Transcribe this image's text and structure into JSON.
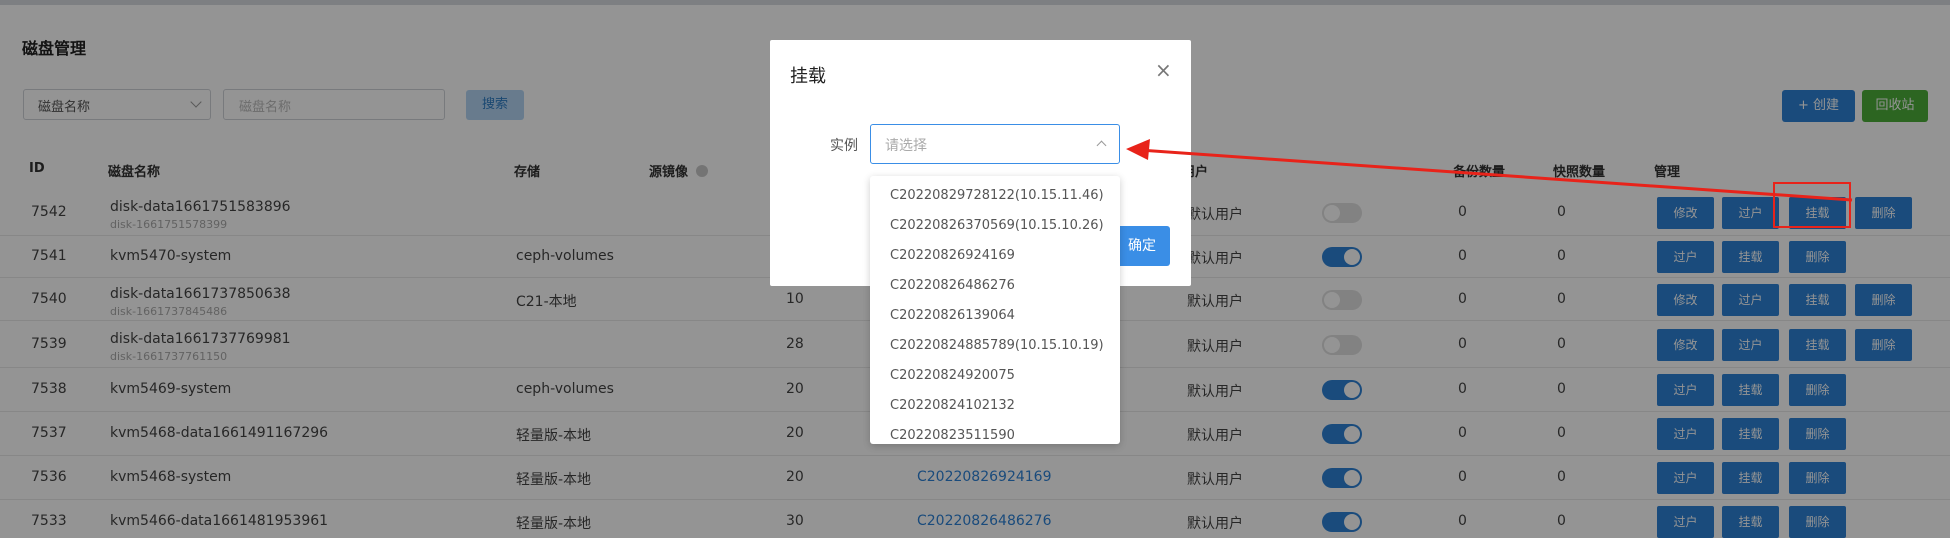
{
  "page": {
    "title": "磁盘管理",
    "filter_select": "磁盘名称",
    "search_placeholder": "磁盘名称",
    "search_button": "搜索",
    "create_button": "+ 创建",
    "recycle_button": "回收站"
  },
  "table": {
    "headers": {
      "id": "ID",
      "name": "磁盘名称",
      "storage": "存储",
      "source_image": "源镜像",
      "user": "用户",
      "backup_count": "备份数量",
      "snapshot_count": "快照数量",
      "manage": "管理"
    },
    "rows": [
      {
        "id": "7542",
        "name": "disk-data1661751583896",
        "sub": "disk-1661751578399",
        "storage": "",
        "size": "",
        "instance": "",
        "user": "默认用户",
        "toggle": false,
        "backup": "0",
        "snapshot": "0",
        "actions": [
          "修改",
          "过户",
          "挂载",
          "删除"
        ]
      },
      {
        "id": "7541",
        "name": "kvm5470-system",
        "sub": "",
        "storage": "ceph-volumes",
        "size": "",
        "instance": "",
        "user": "默认用户",
        "toggle": true,
        "backup": "0",
        "snapshot": "0",
        "actions": [
          "过户",
          "挂载",
          "删除"
        ]
      },
      {
        "id": "7540",
        "name": "disk-data1661737850638",
        "sub": "disk-1661737845486",
        "storage": "C21-本地",
        "size": "10",
        "instance": "",
        "user": "默认用户",
        "toggle": false,
        "backup": "0",
        "snapshot": "0",
        "actions": [
          "修改",
          "过户",
          "挂载",
          "删除"
        ]
      },
      {
        "id": "7539",
        "name": "disk-data1661737769981",
        "sub": "disk-1661737761150",
        "storage": "",
        "size": "28",
        "instance": "",
        "user": "默认用户",
        "toggle": false,
        "backup": "0",
        "snapshot": "0",
        "actions": [
          "修改",
          "过户",
          "挂载",
          "删除"
        ]
      },
      {
        "id": "7538",
        "name": "kvm5469-system",
        "sub": "",
        "storage": "ceph-volumes",
        "size": "20",
        "instance": "",
        "user": "默认用户",
        "toggle": true,
        "backup": "0",
        "snapshot": "0",
        "actions": [
          "过户",
          "挂载",
          "删除"
        ]
      },
      {
        "id": "7537",
        "name": "kvm5468-data1661491167296",
        "sub": "",
        "storage": "轻量版-本地",
        "size": "20",
        "instance": "",
        "user": "默认用户",
        "toggle": true,
        "backup": "0",
        "snapshot": "0",
        "actions": [
          "过户",
          "挂载",
          "删除"
        ]
      },
      {
        "id": "7536",
        "name": "kvm5468-system",
        "sub": "",
        "storage": "轻量版-本地",
        "size": "20",
        "instance": "C20220826924169",
        "user": "默认用户",
        "toggle": true,
        "backup": "0",
        "snapshot": "0",
        "actions": [
          "过户",
          "挂载",
          "删除"
        ]
      },
      {
        "id": "7533",
        "name": "kvm5466-data1661481953961",
        "sub": "",
        "storage": "轻量版-本地",
        "size": "30",
        "instance": "C20220826486276",
        "user": "默认用户",
        "toggle": true,
        "backup": "0",
        "snapshot": "0",
        "actions": [
          "过户",
          "挂载",
          "删除"
        ]
      }
    ]
  },
  "modal": {
    "title": "挂载",
    "close": "×",
    "label": "实例",
    "placeholder": "请选择",
    "confirm": "确定",
    "options": [
      "C20220829728122(10.15.11.46)",
      "C20220826370569(10.15.10.26)",
      "C20220826924169",
      "C20220826486276",
      "C20220826139064",
      "C20220824885789(10.15.10.19)",
      "C20220824920075",
      "C20220824102132",
      "C20220823511590"
    ]
  },
  "colors": {
    "primary": "#2d82d6",
    "success": "#4caf3a",
    "annotation": "#e8231a"
  }
}
